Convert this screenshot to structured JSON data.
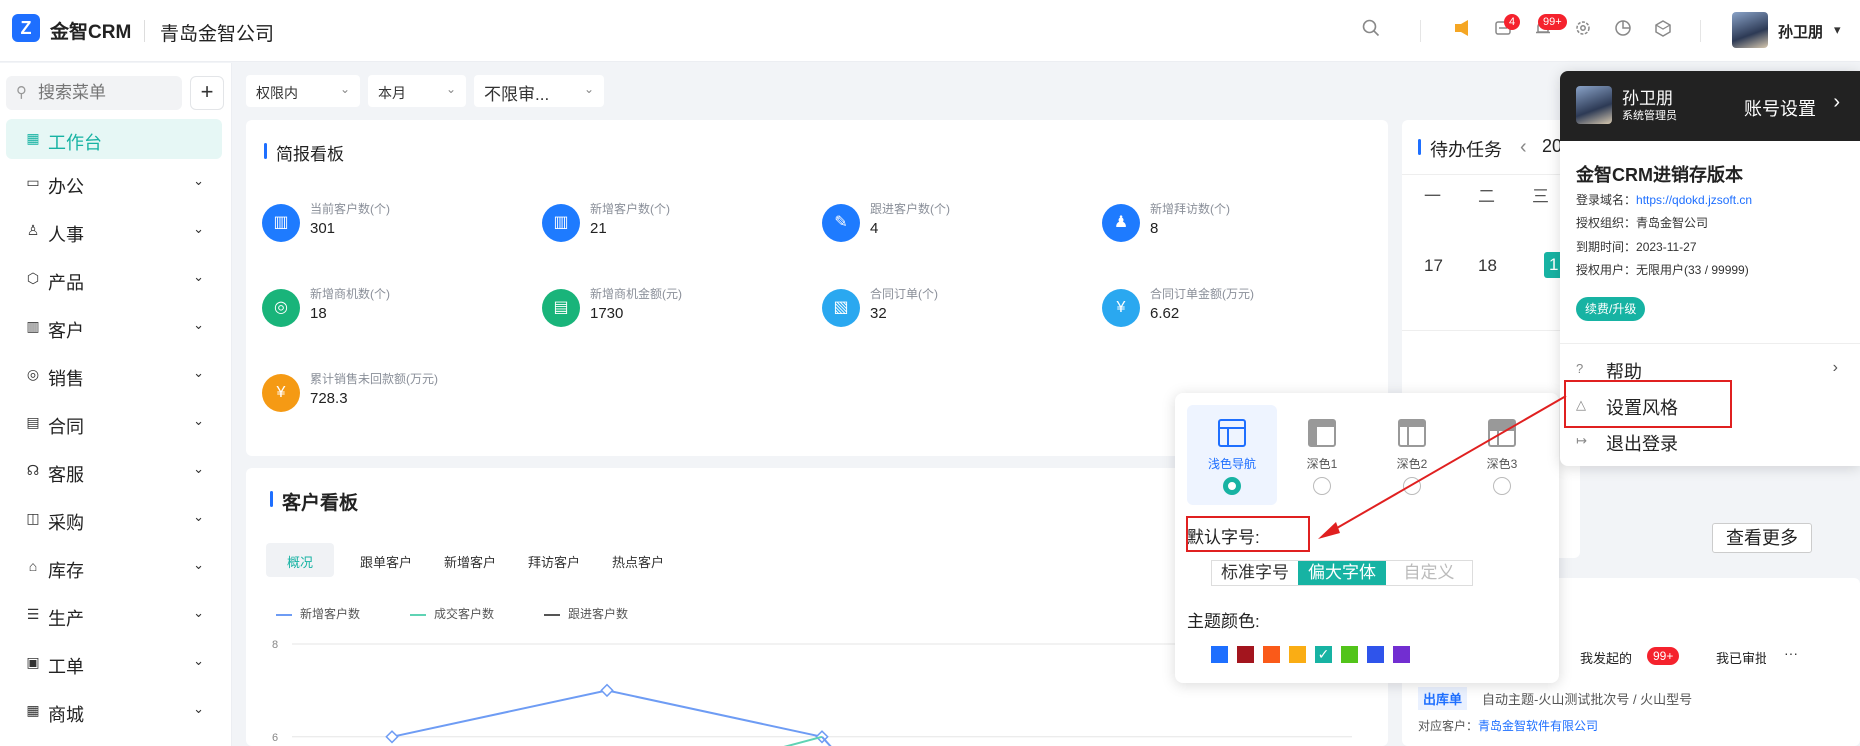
{
  "header": {
    "logo_glyph": "Z",
    "app_name": "金智CRM",
    "company": "青岛金智公司",
    "notification_badge_1": "4",
    "notification_badge_2": "99+",
    "user_name": "孙卫朋"
  },
  "sidebar": {
    "search_placeholder": "搜索菜单",
    "add_label": "+",
    "items": [
      {
        "label": "工作台",
        "icon": "dashboard-icon",
        "active": true
      },
      {
        "label": "办公",
        "icon": "office-icon"
      },
      {
        "label": "人事",
        "icon": "hr-icon"
      },
      {
        "label": "产品",
        "icon": "product-icon"
      },
      {
        "label": "客户",
        "icon": "customer-icon"
      },
      {
        "label": "销售",
        "icon": "sales-icon"
      },
      {
        "label": "合同",
        "icon": "contract-icon"
      },
      {
        "label": "客服",
        "icon": "service-icon"
      },
      {
        "label": "采购",
        "icon": "purchase-icon"
      },
      {
        "label": "库存",
        "icon": "inventory-icon"
      },
      {
        "label": "生产",
        "icon": "production-icon"
      },
      {
        "label": "工单",
        "icon": "workorder-icon"
      },
      {
        "label": "商城",
        "icon": "mall-icon"
      }
    ]
  },
  "filters": {
    "scope": "权限内",
    "period": "本月",
    "review": "不限审..."
  },
  "brief_board": {
    "title": "简报看板",
    "stats": [
      {
        "label": "当前客户数(个)",
        "value": "301",
        "color": "#1e7bff"
      },
      {
        "label": "新增客户数(个)",
        "value": "21",
        "color": "#1e7bff"
      },
      {
        "label": "跟进客户数(个)",
        "value": "4",
        "color": "#1e7bff"
      },
      {
        "label": "新增拜访数(个)",
        "value": "8",
        "color": "#1e7bff"
      },
      {
        "label": "新增商机数(个)",
        "value": "18",
        "color": "#19b47a"
      },
      {
        "label": "新增商机金额(元)",
        "value": "1730",
        "color": "#19b47a"
      },
      {
        "label": "合同订单(个)",
        "value": "32",
        "color": "#2aa8f0"
      },
      {
        "label": "合同订单金额(万元)",
        "value": "6.62",
        "color": "#2aa8f0"
      },
      {
        "label": "累计销售未回款额(万元)",
        "value": "728.3",
        "color": "#f59a14"
      }
    ]
  },
  "customer_board": {
    "title": "客户看板",
    "tabs": [
      "概况",
      "跟单客户",
      "新增客户",
      "拜访客户",
      "热点客户"
    ],
    "legend": [
      "新增客户数",
      "成交客户数",
      "跟进客户数"
    ],
    "legend_colors": [
      "#6e9cf4",
      "#5fd3b4",
      "#555555"
    ],
    "y_ticks": [
      "8",
      "6"
    ]
  },
  "chart_data": {
    "type": "line",
    "title": "",
    "series": [
      {
        "name": "新增客户数",
        "values": [
          6,
          7,
          6
        ]
      },
      {
        "name": "成交客户数",
        "values": [
          null,
          null,
          6
        ]
      }
    ],
    "x": [
      "",
      "",
      ""
    ],
    "ylim": [
      5.5,
      8
    ],
    "grid": true,
    "legend_position": "top-left"
  },
  "todo": {
    "title": "待办任务",
    "year_prefix": "20",
    "prev_icon": "‹",
    "weekdays": [
      "一",
      "二",
      "三"
    ],
    "days": [
      "17",
      "18",
      "1"
    ],
    "more_button": "查看更多"
  },
  "approvals": {
    "tab_started": "我发起的",
    "started_badge": "99+",
    "tab_approved": "我已审批",
    "more_dots": "···",
    "item_tag": "出库单",
    "item_title": "自动主题-火山测试批次号 / 火山型号",
    "customer_label": "对应客户：",
    "customer_name": "青岛金智软件有限公司"
  },
  "style_panel": {
    "options": [
      {
        "label": "浅色导航",
        "selected": true
      },
      {
        "label": "深色1"
      },
      {
        "label": "深色2"
      },
      {
        "label": "深色3"
      }
    ],
    "font_size_label": "默认字号:",
    "font_sizes": [
      "标准字号",
      "偏大字体",
      "自定义"
    ],
    "theme_label": "主题颜色:",
    "theme_colors": [
      "#1e6fff",
      "#a3151e",
      "#fa5a19",
      "#faad14",
      "#17b3a3",
      "#52c41a",
      "#2f54eb",
      "#722ed1"
    ],
    "selected_color_check": "✓"
  },
  "account_menu": {
    "name": "孙卫朋",
    "role": "系统管理员",
    "settings_label": "账号设置",
    "version_title": "金智CRM进销存版本",
    "login_domain_label": "登录域名：",
    "login_domain": "https://qdokd.jzsoft.cn",
    "auth_org_label": "授权组织：",
    "auth_org": "青岛金智公司",
    "expire_label": "到期时间：",
    "expire": "2023-11-27",
    "auth_users_label": "授权用户：",
    "auth_users": "无限用户(33 / 99999)",
    "renew_button": "续费/升级",
    "items": [
      "帮助",
      "设置风格",
      "退出登录"
    ]
  }
}
